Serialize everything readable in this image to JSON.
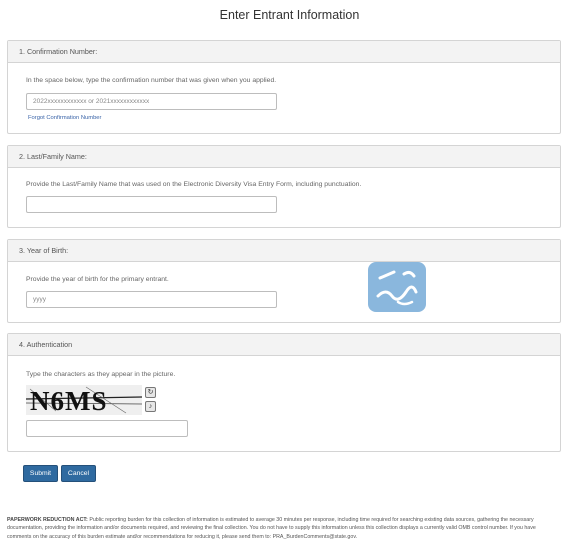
{
  "page": {
    "title": "Enter Entrant Information"
  },
  "sections": {
    "confirmation": {
      "heading": "1. Confirmation Number:",
      "description": "In the space below, type the confirmation number that was given when you applied.",
      "input_placeholder": "2022xxxxxxxxxxxx or 2021xxxxxxxxxxxx",
      "forgot_link": "Forgot Confirmation Number"
    },
    "last_name": {
      "heading": "2. Last/Family Name:",
      "description": "Provide the Last/Family Name that was used on the Electronic Diversity Visa Entry Form, including punctuation.",
      "input_placeholder": ""
    },
    "year_of_birth": {
      "heading": "3. Year of Birth:",
      "description": "Provide the year of birth for the primary entrant.",
      "input_placeholder": "yyyy"
    },
    "authentication": {
      "heading": "4. Authentication",
      "description": "Type the characters as they appear in the picture.",
      "captcha_text": "N6MS",
      "input_value": ""
    }
  },
  "buttons": {
    "submit": "Submit",
    "cancel": "Cancel"
  },
  "notice": {
    "label": "PAPERWORK REDUCTION ACT:",
    "text": "Public reporting burden for this collection of information is estimated to average 30 minutes per response, including time required for searching existing data sources, gathering the necessary documentation, providing the information and/or documents required, and reviewing the final collection. You do not have to supply this information unless this collection displays a currently valid OMB control number. If you have comments on the accuracy of this burden estimate and/or recommendations for reducing it, please send them to: PRA_BurdenComments@state.gov."
  },
  "icons": {
    "captcha_refresh": "refresh-icon",
    "captcha_audio": "audio-icon",
    "watermark": "watermark-logo"
  },
  "colors": {
    "primary_button": "#2f6aa0",
    "link": "#3a64a8",
    "panel_heading": "#f3f3f3"
  }
}
